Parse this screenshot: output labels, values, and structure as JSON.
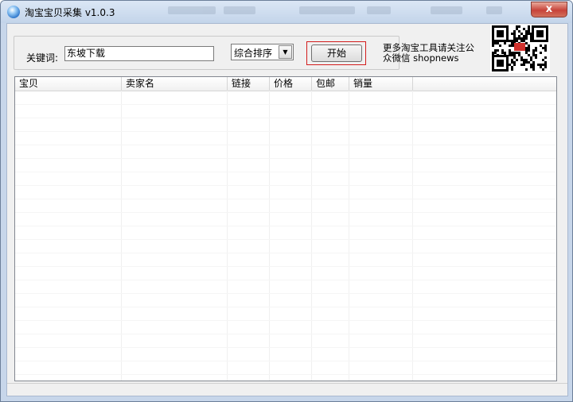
{
  "window": {
    "title": "淘宝宝贝采集 v1.0.3",
    "close_label": "x",
    "accent_close": "#c7433a"
  },
  "search": {
    "label": "关键词:",
    "value": "东坡下载"
  },
  "sort": {
    "selected": "综合排序",
    "arrow": "▼"
  },
  "start_button": {
    "label": "开始"
  },
  "promo": {
    "line1": "更多淘宝工具请关注公",
    "line2": "众微信 shopnews"
  },
  "table": {
    "columns": [
      "宝贝",
      "卖家名",
      "链接",
      "价格",
      "包邮",
      "销量"
    ],
    "rows": []
  }
}
